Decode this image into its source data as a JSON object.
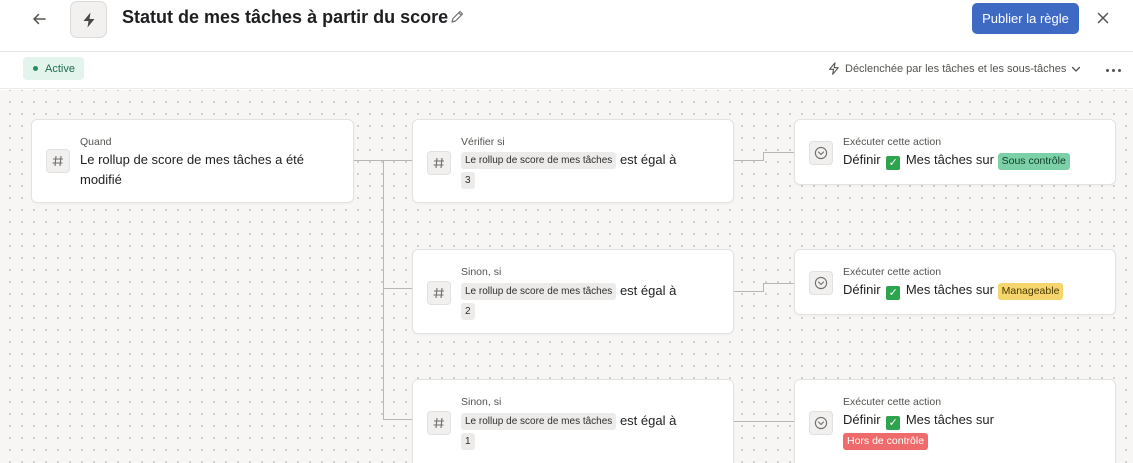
{
  "header": {
    "title": "Statut de mes tâches à partir du score",
    "publish_label": "Publier la règle",
    "back_icon": "arrow-left-icon",
    "close_icon": "close-icon",
    "rule_icon": "lightning-icon"
  },
  "subbar": {
    "status_label": "Active",
    "trigger_label": "Déclenchée par les tâches et les sous-tâches"
  },
  "trigger": {
    "label": "Quand",
    "text": "Le rollup de score de mes tâches a été modifié"
  },
  "conditions": [
    {
      "label": "Vérifier si",
      "field": "Le rollup de score de mes tâches",
      "operator": "est égal à",
      "value": "3"
    },
    {
      "label": "Sinon, si",
      "field": "Le rollup de score de mes tâches",
      "operator": "est égal à",
      "value": "2"
    },
    {
      "label": "Sinon, si",
      "field": "Le rollup de score de mes tâches",
      "operator": "est égal à",
      "value": "1"
    }
  ],
  "actions": [
    {
      "label": "Exécuter cette action",
      "verb": "Définir",
      "target": "Mes tâches sur",
      "tag": "Sous contrôle",
      "tag_color": "#7bd0a8"
    },
    {
      "label": "Exécuter cette action",
      "verb": "Définir",
      "target": "Mes tâches sur",
      "tag": "Manageable",
      "tag_color": "#f6d56c"
    },
    {
      "label": "Exécuter cette action",
      "verb": "Définir",
      "target": "Mes tâches sur",
      "tag": "Hors de contrôle",
      "tag_color": "#ef6a6a"
    }
  ],
  "colors": {
    "publish_button": "#3f6ac4",
    "status_active_bg": "#e2f4ec",
    "status_active_text": "#1f6b4c"
  }
}
